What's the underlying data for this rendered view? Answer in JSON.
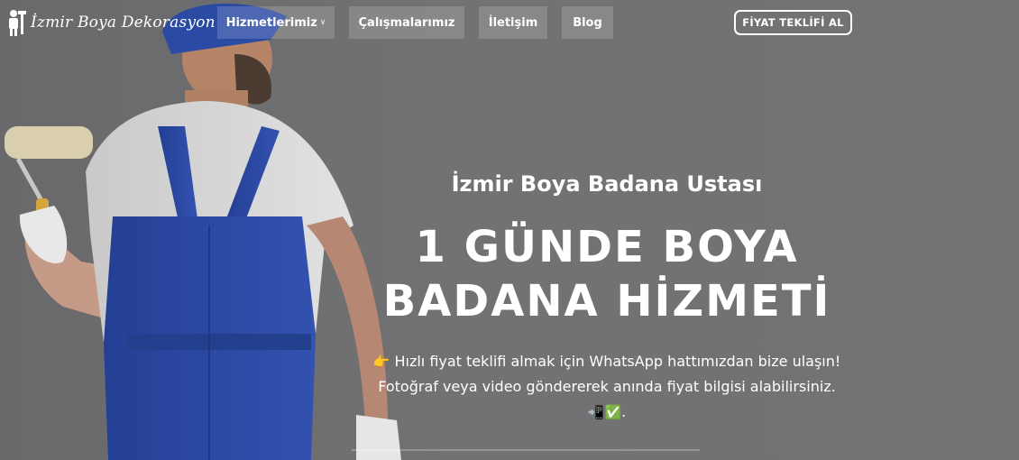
{
  "brand": {
    "name": "İzmir Boya Dekorasyon"
  },
  "nav": {
    "items": [
      {
        "label": "Hizmetlerimiz",
        "has_dropdown": true
      },
      {
        "label": "Çalışmalarımız"
      },
      {
        "label": "İletişim"
      },
      {
        "label": "Blog"
      }
    ]
  },
  "cta": {
    "label": "FİYAT TEKLİFİ AL"
  },
  "hero": {
    "pre_title": "İzmir Boya Badana Ustası",
    "headline_line1": "1 GÜNDE BOYA",
    "headline_line2": "BADANA HİZMETİ",
    "desc_icon": "👉",
    "desc_line1": "Hızlı fiyat teklifi almak için WhatsApp hattımızdan bize ulaşın!",
    "desc_line2": "Fotoğraf veya video göndererek anında fiyat bilgisi alabilirsiniz.",
    "desc_end_icons": "📲✅",
    "desc_end_dot": "."
  },
  "colors": {
    "overlay": "#707072",
    "text": "#ffffff",
    "overall_blue": "#2f49a6"
  }
}
